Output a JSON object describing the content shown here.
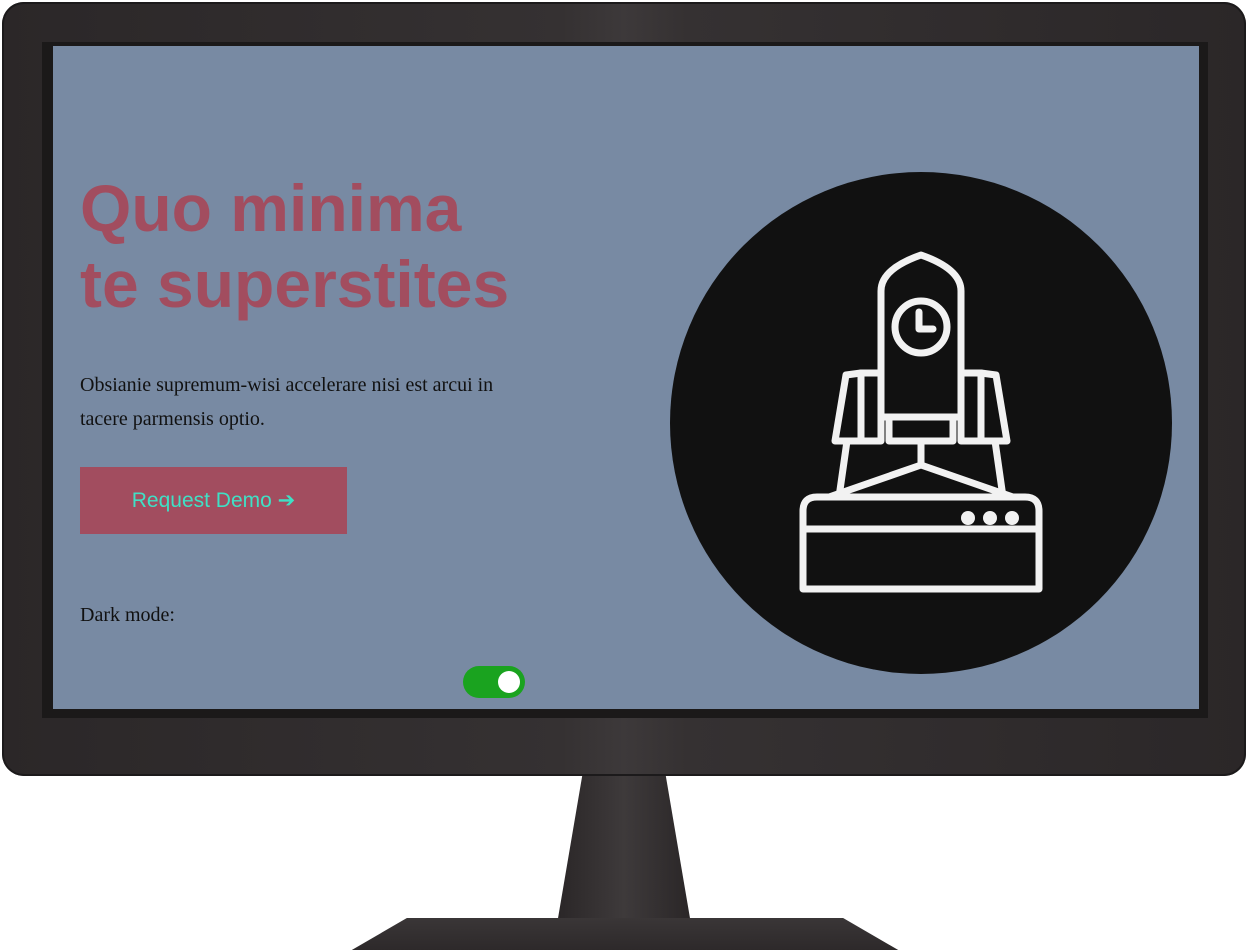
{
  "hero": {
    "title_line1": "Quo minima",
    "title_line2": "te superstites",
    "description": "Obsianie supremum-wisi accelerare nisi est arcui in tacere parmensis optio.",
    "cta_label": "Request Demo ➔"
  },
  "settings": {
    "dark_mode_label": "Dark mode:",
    "dark_mode_on": true
  },
  "illustration": {
    "icon": "rocket-launch-icon"
  },
  "colors": {
    "screen_background": "#788aa3",
    "accent": "#a24d5f",
    "button_text": "#3fe0c5",
    "toggle_on": "#1aa31f",
    "circle": "#111111",
    "icon_stroke": "#f2f2f2"
  }
}
